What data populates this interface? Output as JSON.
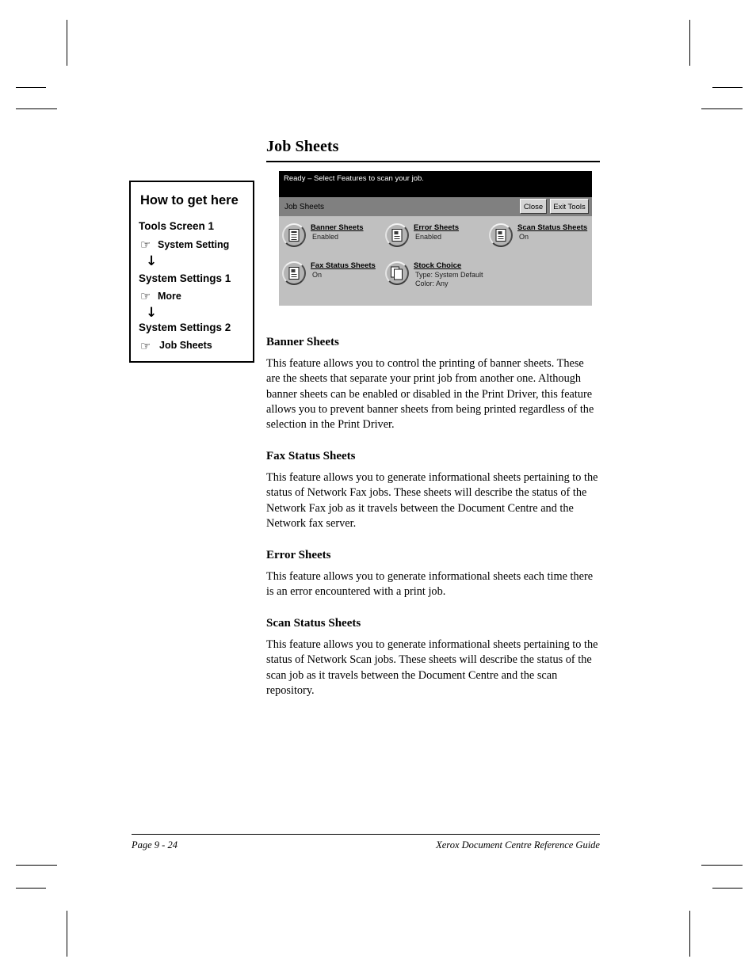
{
  "page_title": "Job Sheets",
  "howto": {
    "title": "How to get here",
    "steps": [
      {
        "screen": "Tools Screen 1",
        "icon": "hand-pointer-icon",
        "item": "System Setting",
        "arrow": "↓"
      },
      {
        "screen": "System Settings 1",
        "icon": "hand-pointer-icon",
        "item": "More",
        "arrow": "↓"
      },
      {
        "screen": "System Settings 2",
        "icon": "hand-pointer-icon",
        "item": "Job Sheets",
        "arrow": ""
      }
    ],
    "hand_glyph": "☞",
    "arrow_glyph": "↓"
  },
  "device_ui": {
    "status_message": "Ready –  Select Features to scan your job.",
    "screen_title": "Job Sheets",
    "buttons": [
      {
        "label": "Close",
        "name": "close-button"
      },
      {
        "label": "Exit Tools",
        "name": "exit-tools-button"
      }
    ],
    "features": [
      {
        "label": "Banner Sheets",
        "value": "Enabled",
        "value2": "",
        "icon": "document-icon"
      },
      {
        "label": "Error Sheets",
        "value": "Enabled",
        "value2": "",
        "icon": "error-sheet-icon"
      },
      {
        "label": "Scan Status Sheets",
        "value": "On",
        "value2": "",
        "icon": "scan-sheet-icon"
      },
      {
        "label": "Fax Status Sheets",
        "value": "On",
        "value2": "",
        "icon": "fax-sheet-icon"
      },
      {
        "label": "Stock Choice",
        "value": "Type:  System Default",
        "value2": "Color:  Any",
        "icon": "paper-stack-icon"
      }
    ],
    "colors": {
      "status_bar": "#000000",
      "title_bar": "#808080",
      "body": "#c0c0c0",
      "button_face": "#d4d4d4"
    }
  },
  "sections": [
    {
      "heading": "Banner Sheets",
      "body": "This feature allows you to control the printing of banner sheets. These are the sheets that separate your print job from another one. Although banner sheets can be enabled or disabled in the Print Driver, this feature allows you to prevent banner sheets from being printed regardless of the selection in the Print Driver."
    },
    {
      "heading": "Fax Status Sheets",
      "body": "This feature allows you to generate informational sheets pertaining to the status of Network Fax jobs. These sheets will describe the status of the Network Fax job as it travels between the Document Centre and the Network fax server."
    },
    {
      "heading": "Error Sheets",
      "body": "This feature allows you to generate informational sheets each time there is an error encountered with a print job."
    },
    {
      "heading": "Scan Status Sheets",
      "body": "This feature allows you to generate informational sheets pertaining to the status of Network Scan jobs. These sheets will describe the status of the scan job as it travels between the Document Centre and the scan repository."
    }
  ],
  "footer": {
    "page_number": "Page 9 - 24",
    "guide_title": "Xerox Document Centre Reference Guide"
  }
}
